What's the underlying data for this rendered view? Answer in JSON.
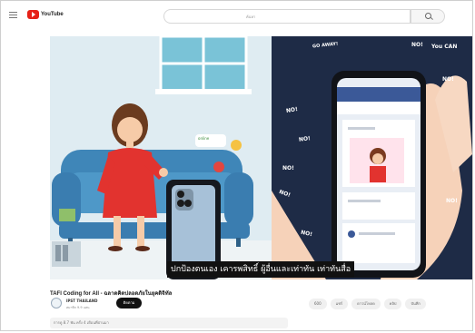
{
  "header": {
    "logo_text": "YouTube",
    "search_placeholder": "ค้นหา"
  },
  "video": {
    "caption": "ปกป้องตนเอง เคารพสิทธิ์ ผู้อื่นและเท่าทัน เท่าทันสื่อ",
    "sticker_text": "online",
    "no_words": [
      "GO AWAY!",
      "NO!",
      "You CAN",
      "NO!",
      "NO!",
      "NO!",
      "NO!",
      "NO!",
      "NO!",
      "NO!"
    ]
  },
  "below": {
    "title": "TAFI Coding for All - ฉลาดคิดปลอดภัยในยุคดิจิทัล",
    "channel_name": "IPST THAILAND",
    "channel_sub": "สมาชิก 9.9 แสน",
    "subscribe": "ติดตาม",
    "actions": [
      "600",
      "แชร์",
      "ดาวน์โหลด",
      "คลิป",
      "บันทึก"
    ],
    "description": "การดู 8.7 พัน ครั้ง  4 เดือนที่ผ่านมา"
  },
  "colors": {
    "brand": "#e62117",
    "night": "#1e2b46"
  }
}
